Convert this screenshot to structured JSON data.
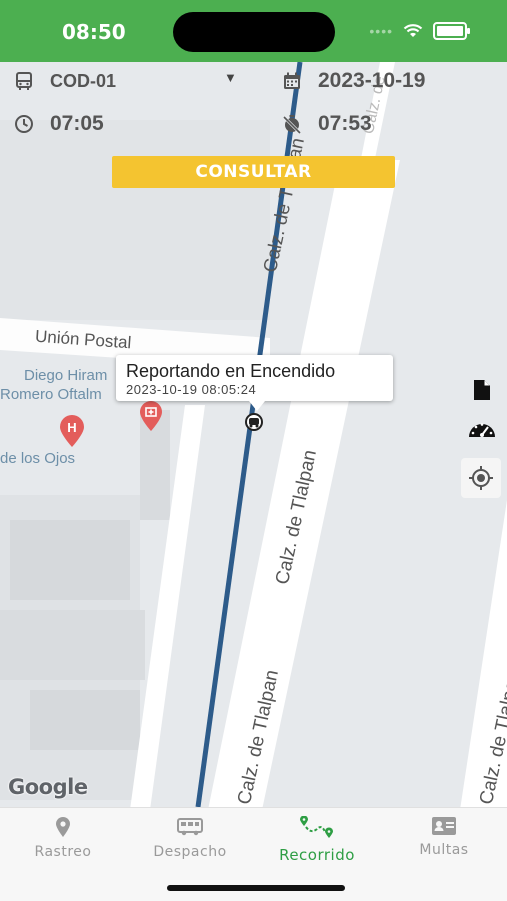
{
  "status_bar": {
    "time": "08:50"
  },
  "filters": {
    "vehicle": "COD-01",
    "date": "2023-10-19",
    "start_time": "07:05",
    "end_time": "07:53",
    "consult_label": "CONSULTAR"
  },
  "map": {
    "labels": {
      "union_postal": "Unión Postal",
      "diego_1": "Diego Hiram",
      "diego_2": "Romero Oftalm",
      "ojos": "de los Ojos",
      "calz_a": "Calz. de Tlalpan",
      "calz_b": "Calz. de Tlalpan",
      "calz_c": "Calz. de Tlalpan",
      "calz_d": "Calz. de Tlalpan",
      "calz_top": "Calz. de",
      "google": "Google"
    },
    "popup": {
      "title": "Reportando en Encendido",
      "timestamp": "2023-10-19 08:05:24"
    }
  },
  "tabs": [
    {
      "label": "Rastreo",
      "icon": "map-pin-icon",
      "active": false
    },
    {
      "label": "Despacho",
      "icon": "bus-icon",
      "active": false
    },
    {
      "label": "Recorrido",
      "icon": "route-icon",
      "active": true
    },
    {
      "label": "Multas",
      "icon": "id-card-icon",
      "active": false
    }
  ],
  "colors": {
    "status_green": "#4caf50",
    "accent_green": "#2e9e44",
    "consult_yellow": "#f4c430",
    "route_blue": "#2d5b8a"
  }
}
